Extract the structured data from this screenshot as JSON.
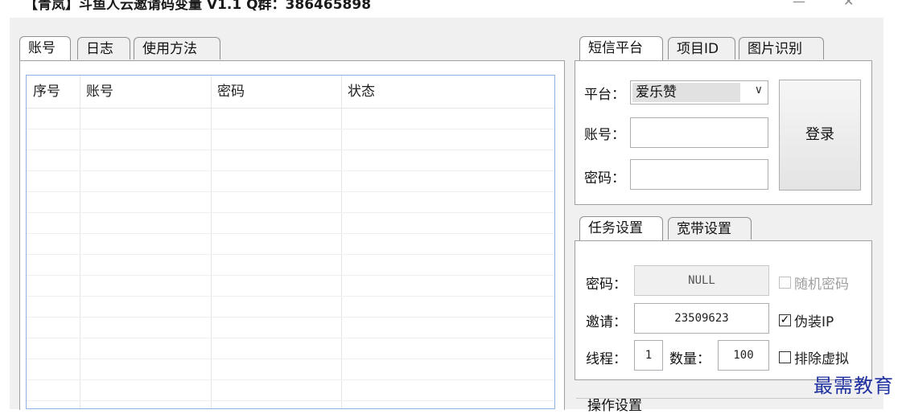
{
  "window": {
    "title": "【青岚】斗鱼人云邀请码变量 V1.1 Q群：386465898",
    "minimize": "—",
    "close": "✕"
  },
  "left_tabs": [
    "账号",
    "日志",
    "使用方法"
  ],
  "table": {
    "columns": [
      "序号",
      "账号",
      "密码",
      "状态"
    ],
    "rows": []
  },
  "sms_tabs": [
    "短信平台",
    "项目ID",
    "图片识别"
  ],
  "sms": {
    "platform_label": "平台：",
    "platform_value": "爱乐赞",
    "account_label": "账号：",
    "account_value": "",
    "password_label": "密码：",
    "password_value": "",
    "login_button": "登录"
  },
  "task_tabs": [
    "任务设置",
    "宽带设置"
  ],
  "task": {
    "password_label": "密码：",
    "password_value": "NULL",
    "random_password_label": "随机密码",
    "random_password_checked": false,
    "invite_label": "邀请：",
    "invite_value": "23509623",
    "fake_ip_label": "伪装IP",
    "fake_ip_checked": true,
    "threads_label": "线程：",
    "threads_value": "1",
    "count_label": "数量：",
    "count_value": "100",
    "exclude_virtual_label": "排除虚拟",
    "exclude_virtual_checked": false
  },
  "operations": {
    "group_label": "操作设置"
  },
  "watermark": "最需教育"
}
